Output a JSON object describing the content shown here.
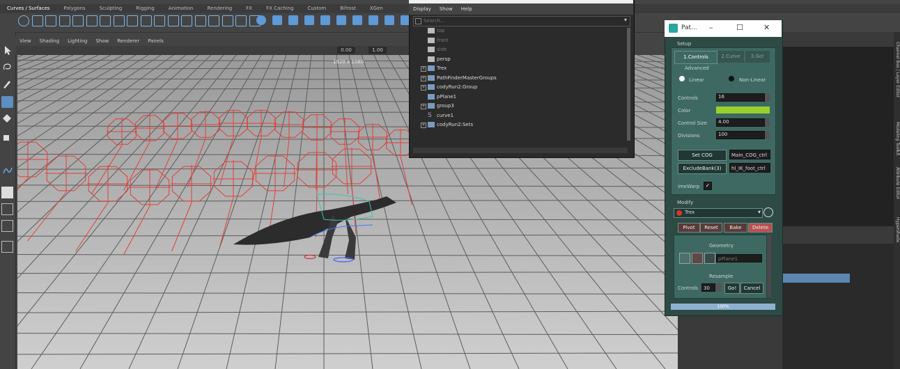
{
  "shelf": {
    "tabs": [
      "Curves / Surfaces",
      "Polygons",
      "Sculpting",
      "Rigging",
      "Animation",
      "Rendering",
      "FX",
      "FX Caching",
      "Custom",
      "Bifrost",
      "XGen"
    ]
  },
  "viewport": {
    "menu": [
      "View",
      "Shading",
      "Lighting",
      "Show",
      "Renderer",
      "Panels"
    ],
    "field_a": "0.00",
    "field_b": "1.00",
    "resolution_label": "1920 x 1080"
  },
  "outliner": {
    "menu": [
      "Display",
      "Show",
      "Help"
    ],
    "search_placeholder": "Search...",
    "items": [
      {
        "label": "top",
        "dim": true,
        "expand": false,
        "icon": "camera-icon"
      },
      {
        "label": "front",
        "dim": true,
        "expand": false,
        "icon": "camera-icon"
      },
      {
        "label": "side",
        "dim": true,
        "expand": false,
        "icon": "camera-icon"
      },
      {
        "label": "persp",
        "dim": false,
        "expand": false,
        "icon": "camera-icon"
      },
      {
        "label": "Trex",
        "dim": false,
        "expand": true,
        "icon": "mesh-icon"
      },
      {
        "label": "PathFinderMasterGroups",
        "dim": false,
        "expand": true,
        "icon": "group-icon"
      },
      {
        "label": "codyRun2:Group",
        "dim": false,
        "expand": true,
        "icon": "group-icon"
      },
      {
        "label": "pPlane1",
        "dim": false,
        "expand": false,
        "icon": "plane-icon"
      },
      {
        "label": "group3",
        "dim": false,
        "expand": true,
        "icon": "group-icon"
      },
      {
        "label": "curve1",
        "dim": false,
        "expand": false,
        "icon": "curve-icon"
      },
      {
        "label": "codyRun2:Sets",
        "dim": false,
        "expand": true,
        "icon": "set-icon"
      }
    ]
  },
  "plugin": {
    "title": "Pat...",
    "setup_label": "Setup",
    "tabs": [
      "1.Controls",
      "2.Curve",
      "3.Go!"
    ],
    "advanced_label": "Advanced",
    "radio_linear": "Linear",
    "radio_nonlinear": "Non-Linear",
    "controls_label": "Controls",
    "controls_value": "16",
    "color_label": "Color",
    "color_value": "#9ad02a",
    "control_size_label": "Control Size",
    "control_size_value": "4.00",
    "divisions_label": "Divisions",
    "divisions_value": "100",
    "set_cog_button": "Set COG",
    "cog_field": "Main_COG_ctrl",
    "exclude_button": "ExcludeBank(3)",
    "exclude_field": "hl_IK_foot_ctrl",
    "timewarp_label": "imeWarp",
    "modify_label": "Modify",
    "modify_select": "Trex",
    "pivot_button": "Pivot",
    "reset_button": "Reset",
    "bake_button": "Bake",
    "delete_button": "Delete",
    "geometry_label": "Geometry",
    "geometry_field": "pPlane1",
    "resample_label": "Resample",
    "resample_controls_label": "Controls",
    "resample_value": "30",
    "go_button": "Go!",
    "cancel_button": "Cancel",
    "progress_label": "100%",
    "progress": 1.0
  },
  "right_panel": {
    "vertical_tabs": [
      "Channel Box / Layer Editor",
      "Modeling Toolkit",
      "Attribute Editor",
      "Hypershade"
    ]
  },
  "colors": {
    "wire_red": "#e0403a",
    "plugin_teal": "#2d4a45",
    "delete_red": "#b85050"
  }
}
